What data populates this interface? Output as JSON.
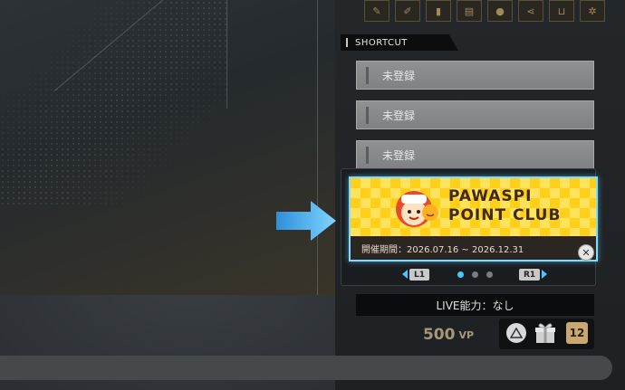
{
  "shortcut": {
    "header": "SHORTCUT",
    "slots": [
      "未登録",
      "未登録",
      "未登録"
    ]
  },
  "banner": {
    "title_line1": "PAWASPI",
    "title_line2": "POINT CLUB",
    "period": "開催期間：2026.07.16 ~ 2026.12.31"
  },
  "pager": {
    "left_label": "L1",
    "right_label": "R1",
    "total": 3,
    "active": 1
  },
  "live": "LIVE能力：なし",
  "vp": {
    "value": "500",
    "unit": "VP"
  },
  "badge": "12",
  "top_icons": [
    "pencil-icon",
    "edit-icon",
    "book-icon",
    "document-icon",
    "person-icon",
    "share-icon",
    "cart-icon",
    "gear-icon"
  ],
  "colors": {
    "accent": "#48c8ff",
    "banner_yellow": "#ffcf1a",
    "gold": "#c8a870"
  }
}
